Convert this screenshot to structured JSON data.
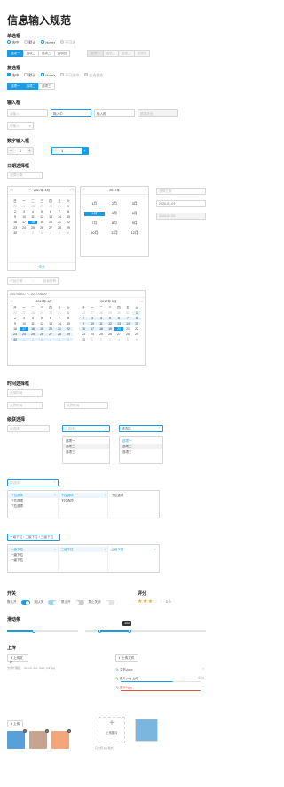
{
  "title": "信息输入规范",
  "sections": {
    "radio": "单选框",
    "checkbox": "复选框",
    "input": "输入框",
    "number": "数字输入框",
    "date": "日期选择框",
    "time": "时间选择框",
    "select": "级联选择",
    "switch": "开关",
    "rate": "评分",
    "slider": "滑动条",
    "upload": "上传"
  },
  "radio": {
    "items": [
      "选中",
      "默认",
      "Hover",
      "不可选"
    ],
    "seg": [
      "选项一",
      "选项二",
      "选项三",
      "选项四"
    ],
    "seg_dis": [
      "选项一",
      "选项二",
      "选项三",
      "选项四"
    ]
  },
  "checkbox": {
    "items": [
      "选中",
      "默认",
      "Hover",
      "不可选中",
      "全选状态"
    ],
    "seg": [
      "选项一",
      "选项二",
      "选项三"
    ]
  },
  "input": {
    "placeholder": "请输入",
    "hover": "输入中",
    "active": "输入框",
    "disabled": "禁用状态",
    "search": "请输入"
  },
  "number": {
    "v1": "1",
    "v2": "1"
  },
  "date": {
    "placeholder": "选择日期",
    "month_header": "2017年 4月",
    "year_header": "2017年",
    "weekdays": [
      "日",
      "一",
      "二",
      "三",
      "四",
      "五",
      "六"
    ],
    "days": [
      "26",
      "27",
      "28",
      "29",
      "30",
      "31",
      "1",
      "2",
      "3",
      "4",
      "5",
      "6",
      "7",
      "8",
      "9",
      "10",
      "11",
      "12",
      "13",
      "14",
      "15",
      "16",
      "17",
      "18",
      "19",
      "20",
      "21",
      "22",
      "23",
      "24",
      "25",
      "26",
      "27",
      "28",
      "29",
      "30",
      "1",
      "2",
      "3",
      "4",
      "5",
      "6"
    ],
    "today": "今天",
    "months": [
      "1月",
      "2月",
      "3月",
      "4月",
      "5月",
      "6月",
      "7月",
      "8月",
      "9月",
      "10月",
      "11月",
      "12月"
    ],
    "r1": "选择日期",
    "r2": "2020-01-01",
    "r3": "2020-01-01"
  },
  "range": {
    "start": "开始日期",
    "end": "结束日期",
    "value": "2017/04/17 ～ 2017/05/20",
    "left": "2017年 4月",
    "right": "2017年 5月"
  },
  "time": {
    "t1": "选择时间",
    "t2": "选择时间",
    "t3": "选择时间"
  },
  "cascade": {
    "s1": "请选择",
    "s2": "请选择",
    "s3": "请选择",
    "opts": [
      "选项一",
      "选项二",
      "选项三"
    ],
    "sel": "请选择",
    "cols": [
      [
        "下拉选项",
        "下拉选项",
        "下拉选项"
      ],
      [
        "下拉选项",
        "下拉选项"
      ],
      [
        "下拉选项"
      ]
    ],
    "path": "一级下拉 / 二级下拉 / 三级下拉",
    "levels": [
      "一级下拉",
      "一级下拉",
      "一级下拉"
    ],
    "lv2": "二级下拉",
    "lv3": "三级下拉"
  },
  "switch": {
    "labels": [
      "默认开",
      "默认关",
      "禁止开",
      "禁止关闭"
    ],
    "rate_text": "3.0"
  },
  "slider": {
    "value": "100"
  },
  "upload": {
    "btn": "上传文件",
    "hint": "支持扩展名：.rar .zip .doc .docx .pdf .jpg...",
    "btn2": "上传文件",
    "files": [
      {
        "name": "文档.docx",
        "pct": ""
      },
      {
        "name": "图片.png 上传...",
        "pct": "65%"
      },
      {
        "name": "图片2.jpg",
        "pct": ""
      }
    ],
    "img_btn": "上传",
    "card": "上传图片",
    "card_hint": "只支持 jpg 格式"
  },
  "colors": {
    "accent": "#1a9be6"
  }
}
